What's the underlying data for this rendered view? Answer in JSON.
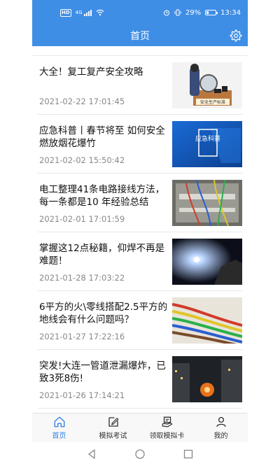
{
  "status_bar": {
    "left_icons": [
      "hd-badge",
      "signal-4g",
      "wifi-icon"
    ],
    "hd_label": "HD",
    "net_label": "4G",
    "battery_percent": "29%",
    "battery_level": 0.29,
    "time": "13:34"
  },
  "header": {
    "title": "首页",
    "settings_icon": "gear-icon"
  },
  "articles": [
    {
      "title": "大全！复工复产安全攻略",
      "date": "2021-02-22 17:01:45",
      "thumb": "safety-production-illustration",
      "thumb_caption": "安全生产标准"
    },
    {
      "title": "应急科普丨春节将至 如何安全燃放烟花爆竹",
      "date": "2021-02-02 15:50:42",
      "thumb": "emergency-science-banner",
      "thumb_caption": "应急科普"
    },
    {
      "title": "电工整理41条电路接线方法，每一条都是10 年经验总结",
      "date": "2021-02-01 17:01:59",
      "thumb": "electrical-wiring-photo"
    },
    {
      "title": "掌握这12点秘籍，仰焊不再是难题！",
      "date": "2021-01-28 17:03:22",
      "thumb": "welding-photo"
    },
    {
      "title": "6平方的火\\零线搭配2.5平方的地线会有什么问题吗？",
      "date": "2021-01-27 17:22:16",
      "thumb": "colored-wires-photo"
    },
    {
      "title": "突发!大连一管道泄漏爆炸，已致3死8伤!",
      "date": "2021-01-26 17:14:21",
      "thumb": "explosion-night-photo"
    }
  ],
  "tabs": [
    {
      "label": "首页",
      "icon": "home-icon",
      "active": true
    },
    {
      "label": "模拟考试",
      "icon": "edit-icon",
      "active": false
    },
    {
      "label": "领取模拟卡",
      "icon": "card-icon",
      "active": false
    },
    {
      "label": "我的",
      "icon": "user-icon",
      "active": false
    }
  ],
  "colors": {
    "primary": "#3f8ee6",
    "tab_active": "#2f7fe0",
    "text_muted": "#888888"
  }
}
